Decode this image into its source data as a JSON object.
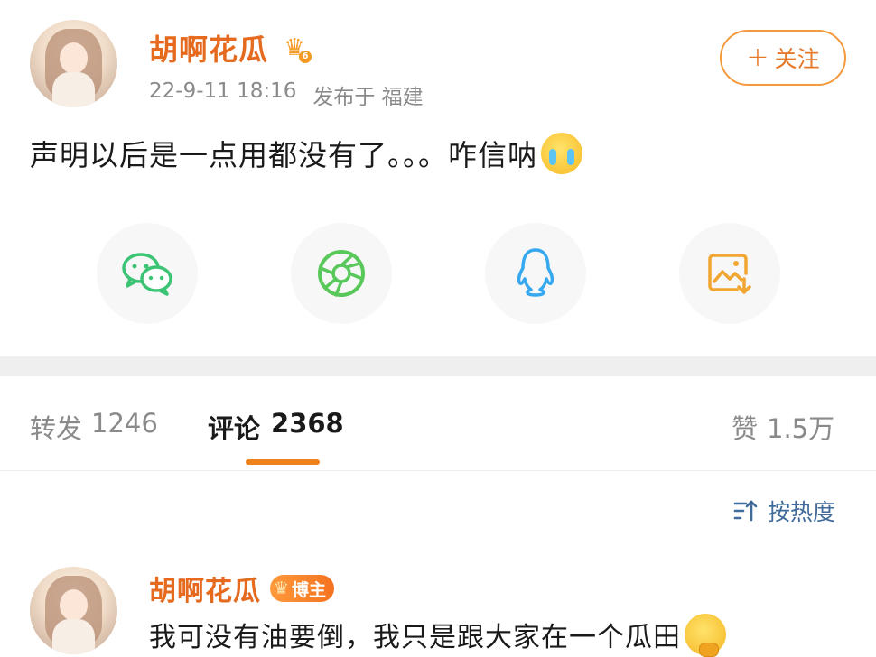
{
  "post": {
    "author": "胡啊花瓜",
    "date": "22-9-11 18:16",
    "location_label": "发布于 福建",
    "follow_label": "关注",
    "text": "声明以后是一点用都没有了。。。咋信呐",
    "emoji": "crying-face",
    "crown_level": "6"
  },
  "share": {
    "items": [
      {
        "name": "wechat",
        "icon": "wechat-icon",
        "color": "#3cc475"
      },
      {
        "name": "moments",
        "icon": "moments-shutter-icon",
        "color": "#58c85a"
      },
      {
        "name": "qq",
        "icon": "qq-penguin-icon",
        "color": "#35a8f0"
      },
      {
        "name": "save-image",
        "icon": "image-download-icon",
        "color": "#f0a630"
      }
    ]
  },
  "tabs": {
    "repost_label": "转发",
    "repost_count": "1246",
    "comment_label": "评论",
    "comment_count": "2368",
    "like_label": "赞",
    "like_count": "1.5万"
  },
  "sort": {
    "label": "按热度"
  },
  "comment": {
    "author": "胡啊花瓜",
    "badge": "博主",
    "crown_level": "6",
    "text": "我可没有油要倒，我只是跟大家在一个瓜田",
    "emoji": "thinking-face"
  },
  "colors": {
    "accent": "#f0821e",
    "username": "#e56a1e",
    "link_blue": "#3f6a9a"
  }
}
